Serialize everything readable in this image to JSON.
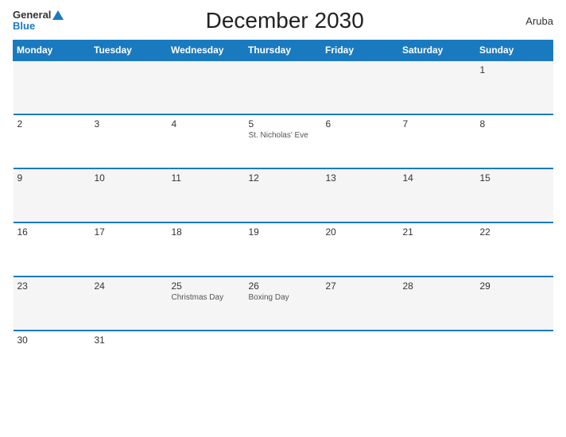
{
  "header": {
    "logo_general": "General",
    "logo_blue": "Blue",
    "title": "December 2030",
    "region": "Aruba"
  },
  "weekdays": [
    "Monday",
    "Tuesday",
    "Wednesday",
    "Thursday",
    "Friday",
    "Saturday",
    "Sunday"
  ],
  "weeks": [
    [
      {
        "day": "",
        "event": ""
      },
      {
        "day": "",
        "event": ""
      },
      {
        "day": "",
        "event": ""
      },
      {
        "day": "",
        "event": ""
      },
      {
        "day": "",
        "event": ""
      },
      {
        "day": "",
        "event": ""
      },
      {
        "day": "1",
        "event": ""
      }
    ],
    [
      {
        "day": "2",
        "event": ""
      },
      {
        "day": "3",
        "event": ""
      },
      {
        "day": "4",
        "event": ""
      },
      {
        "day": "5",
        "event": "St. Nicholas' Eve"
      },
      {
        "day": "6",
        "event": ""
      },
      {
        "day": "7",
        "event": ""
      },
      {
        "day": "8",
        "event": ""
      }
    ],
    [
      {
        "day": "9",
        "event": ""
      },
      {
        "day": "10",
        "event": ""
      },
      {
        "day": "11",
        "event": ""
      },
      {
        "day": "12",
        "event": ""
      },
      {
        "day": "13",
        "event": ""
      },
      {
        "day": "14",
        "event": ""
      },
      {
        "day": "15",
        "event": ""
      }
    ],
    [
      {
        "day": "16",
        "event": ""
      },
      {
        "day": "17",
        "event": ""
      },
      {
        "day": "18",
        "event": ""
      },
      {
        "day": "19",
        "event": ""
      },
      {
        "day": "20",
        "event": ""
      },
      {
        "day": "21",
        "event": ""
      },
      {
        "day": "22",
        "event": ""
      }
    ],
    [
      {
        "day": "23",
        "event": ""
      },
      {
        "day": "24",
        "event": ""
      },
      {
        "day": "25",
        "event": "Christmas Day"
      },
      {
        "day": "26",
        "event": "Boxing Day"
      },
      {
        "day": "27",
        "event": ""
      },
      {
        "day": "28",
        "event": ""
      },
      {
        "day": "29",
        "event": ""
      }
    ],
    [
      {
        "day": "30",
        "event": ""
      },
      {
        "day": "31",
        "event": ""
      },
      {
        "day": "",
        "event": ""
      },
      {
        "day": "",
        "event": ""
      },
      {
        "day": "",
        "event": ""
      },
      {
        "day": "",
        "event": ""
      },
      {
        "day": "",
        "event": ""
      }
    ]
  ]
}
